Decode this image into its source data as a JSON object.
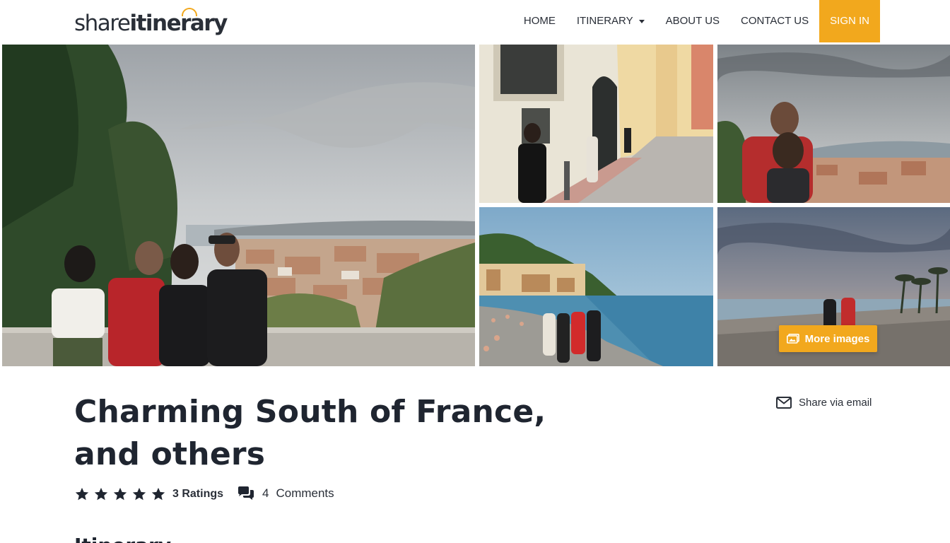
{
  "brand": {
    "logo_part1": "share",
    "logo_part2": "itinerary"
  },
  "nav": {
    "items": [
      {
        "label": "HOME"
      },
      {
        "label": "ITINERARY",
        "has_dropdown": true
      },
      {
        "label": "ABOUT US"
      },
      {
        "label": "CONTACT US"
      }
    ],
    "signin_label": "SIGN IN"
  },
  "gallery": {
    "more_images_label": "More images"
  },
  "trip": {
    "title": "Charming South of France, and others",
    "share_label": "Share via email",
    "rating_stars": 5,
    "ratings_label": "3 Ratings",
    "comments_count": "4",
    "comments_label": "Comments"
  },
  "section_heading": "Itinerary",
  "colors": {
    "accent": "#f2a81d",
    "text": "#1f2530"
  }
}
